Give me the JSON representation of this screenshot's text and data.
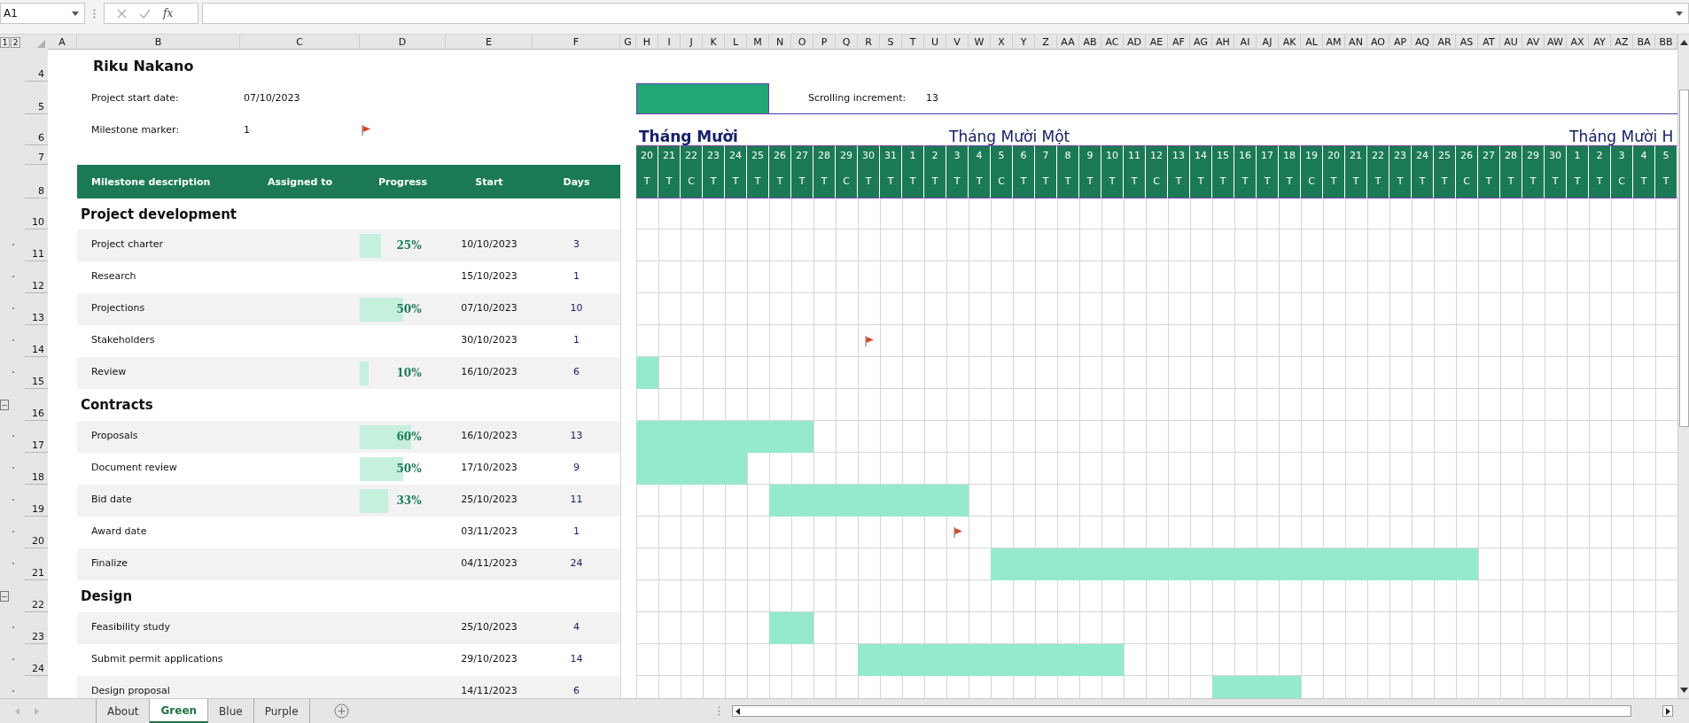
{
  "formula_bar": {
    "name_box": "A1",
    "function_label": "fx"
  },
  "outline_levels": [
    "1",
    "2"
  ],
  "column_headers": [
    "A",
    "B",
    "C",
    "D",
    "E",
    "F",
    "G",
    "H",
    "I",
    "J",
    "K",
    "L",
    "M",
    "N",
    "O",
    "P",
    "Q",
    "R",
    "S",
    "T",
    "U",
    "V",
    "W",
    "X",
    "Y",
    "Z",
    "AA",
    "AB",
    "AC",
    "AD",
    "AE",
    "AF",
    "AG",
    "AH",
    "AI",
    "AJ",
    "AK",
    "AL",
    "AM",
    "AN",
    "AO",
    "AP",
    "AQ",
    "AR",
    "AS",
    "AT",
    "AU",
    "AV",
    "AW",
    "AX",
    "AY",
    "AZ",
    "BA",
    "BB"
  ],
  "header_row_numbers": [
    "4",
    "5",
    "6",
    "7",
    "8"
  ],
  "project": {
    "title": "Riku Nakano",
    "start_label": "Project start date:",
    "start_date": "07/10/2023",
    "marker_label": "Milestone marker:",
    "marker_value": "1"
  },
  "scroll": {
    "label": "Scrolling increment:",
    "value": "13"
  },
  "table_columns": [
    "Milestone description",
    "Assigned to",
    "Progress",
    "Start",
    "Days"
  ],
  "timeline": [
    {
      "day": "20",
      "weekday": "T",
      "month": "Tháng Mười",
      "bold": true
    },
    {
      "day": "21",
      "weekday": "T"
    },
    {
      "day": "22",
      "weekday": "C"
    },
    {
      "day": "23",
      "weekday": "T"
    },
    {
      "day": "24",
      "weekday": "T"
    },
    {
      "day": "25",
      "weekday": "T"
    },
    {
      "day": "26",
      "weekday": "T"
    },
    {
      "day": "27",
      "weekday": "T"
    },
    {
      "day": "28",
      "weekday": "T"
    },
    {
      "day": "29",
      "weekday": "C"
    },
    {
      "day": "30",
      "weekday": "T"
    },
    {
      "day": "31",
      "weekday": "T"
    },
    {
      "day": "1",
      "weekday": "T"
    },
    {
      "day": "2",
      "weekday": "T"
    },
    {
      "day": "3",
      "weekday": "T",
      "month": "Tháng Mười Một",
      "bold": false
    },
    {
      "day": "4",
      "weekday": "T"
    },
    {
      "day": "5",
      "weekday": "C"
    },
    {
      "day": "6",
      "weekday": "T"
    },
    {
      "day": "7",
      "weekday": "T"
    },
    {
      "day": "8",
      "weekday": "T"
    },
    {
      "day": "9",
      "weekday": "T"
    },
    {
      "day": "10",
      "weekday": "T"
    },
    {
      "day": "11",
      "weekday": "T"
    },
    {
      "day": "12",
      "weekday": "C"
    },
    {
      "day": "13",
      "weekday": "T"
    },
    {
      "day": "14",
      "weekday": "T"
    },
    {
      "day": "15",
      "weekday": "T"
    },
    {
      "day": "16",
      "weekday": "T"
    },
    {
      "day": "17",
      "weekday": "T"
    },
    {
      "day": "18",
      "weekday": "T"
    },
    {
      "day": "19",
      "weekday": "C"
    },
    {
      "day": "20",
      "weekday": "T"
    },
    {
      "day": "21",
      "weekday": "T"
    },
    {
      "day": "22",
      "weekday": "T"
    },
    {
      "day": "23",
      "weekday": "T"
    },
    {
      "day": "24",
      "weekday": "T"
    },
    {
      "day": "25",
      "weekday": "T"
    },
    {
      "day": "26",
      "weekday": "C"
    },
    {
      "day": "27",
      "weekday": "T"
    },
    {
      "day": "28",
      "weekday": "T"
    },
    {
      "day": "29",
      "weekday": "T"
    },
    {
      "day": "30",
      "weekday": "T"
    },
    {
      "day": "1",
      "weekday": "T",
      "month": "Tháng Mười H",
      "bold": false
    },
    {
      "day": "2",
      "weekday": "T"
    },
    {
      "day": "3",
      "weekday": "C"
    },
    {
      "day": "4",
      "weekday": "T"
    },
    {
      "day": "5",
      "weekday": "T"
    }
  ],
  "sections": [
    {
      "row_number": "10",
      "title": "Project development",
      "collapse_button": false,
      "tasks": [
        {
          "row_number": "11",
          "name": "Project charter",
          "progress": "25%",
          "level": 0.25,
          "start": "10/10/2023",
          "days": "3"
        },
        {
          "row_number": "12",
          "name": "Research",
          "start": "15/10/2023",
          "days": "1"
        },
        {
          "row_number": "13",
          "name": "Projections",
          "progress": "50%",
          "level": 0.5,
          "start": "07/10/2023",
          "days": "10"
        },
        {
          "row_number": "14",
          "name": "Stakeholders",
          "start": "30/10/2023",
          "days": "1"
        },
        {
          "row_number": "15",
          "name": "Review",
          "progress": "10%",
          "level": 0.1,
          "start": "16/10/2023",
          "days": "6"
        }
      ]
    },
    {
      "row_number": "16",
      "title": "Contracts",
      "collapse_button": true,
      "tasks": [
        {
          "row_number": "17",
          "name": "Proposals",
          "progress": "60%",
          "level": 0.6,
          "start": "16/10/2023",
          "days": "13"
        },
        {
          "row_number": "18",
          "name": "Document review",
          "progress": "50%",
          "level": 0.5,
          "start": "17/10/2023",
          "days": "9"
        },
        {
          "row_number": "19",
          "name": "Bid date",
          "progress": "33%",
          "level": 0.33,
          "start": "25/10/2023",
          "days": "11"
        },
        {
          "row_number": "20",
          "name": "Award date",
          "start": "03/11/2023",
          "days": "1"
        },
        {
          "row_number": "21",
          "name": "Finalize",
          "start": "04/11/2023",
          "days": "24"
        }
      ]
    },
    {
      "row_number": "22",
      "title": "Design",
      "collapse_button": true,
      "tasks": [
        {
          "row_number": "23",
          "name": "Feasibility study",
          "start": "25/10/2023",
          "days": "4"
        },
        {
          "row_number": "24",
          "name": "Submit permit applications",
          "start": "29/10/2023",
          "days": "14"
        },
        {
          "name": "Design proposal",
          "start": "14/11/2023",
          "days": "6"
        }
      ]
    }
  ],
  "sheet_tabs": [
    {
      "label": "About",
      "selected": false
    },
    {
      "label": "Green",
      "selected": true
    },
    {
      "label": "Blue",
      "selected": false
    },
    {
      "label": "Purple",
      "selected": false
    }
  ]
}
